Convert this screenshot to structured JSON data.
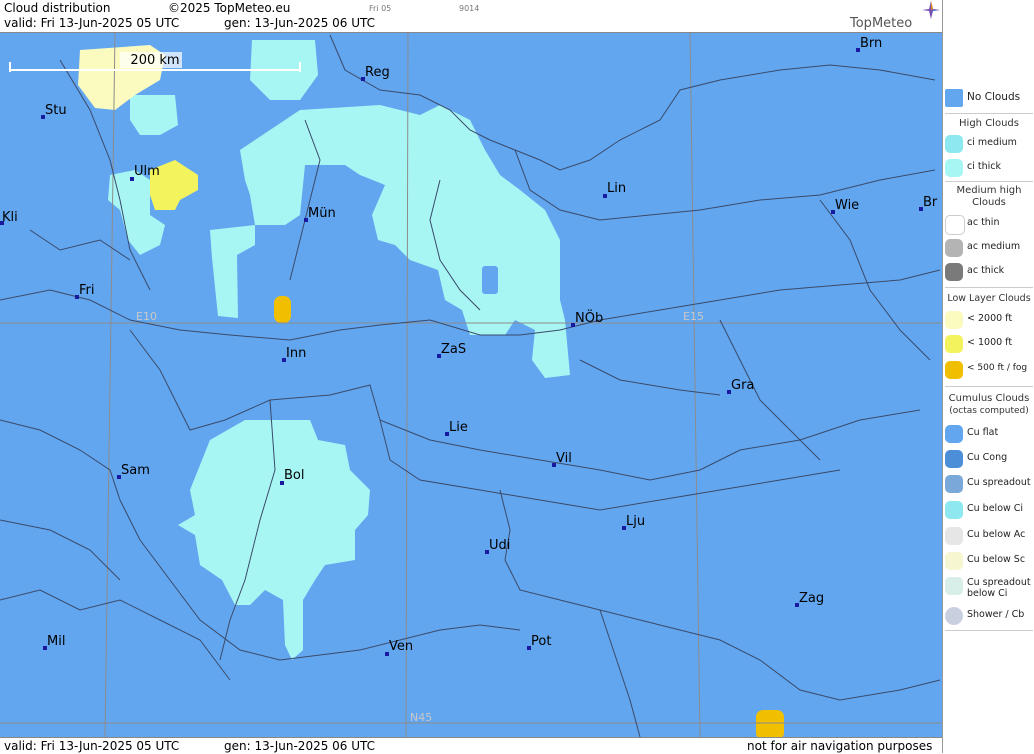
{
  "header": {
    "title": "Cloud distribution",
    "copyright": "©2025 TopMeteo.eu",
    "day_label": "Fri 05",
    "code_label": "9014",
    "valid": "valid:  Fri  13-Jun-2025  05 UTC",
    "gen": "gen: 13-Jun-2025 06 UTC",
    "brand": "TopMeteo"
  },
  "footer": {
    "valid": "valid:  Fri  13-Jun-2025  05 UTC",
    "gen": "gen: 13-Jun-2025 06 UTC",
    "disclaimer": "not for air navigation purposes"
  },
  "map": {
    "scale_label": "200 km",
    "grid_labels": {
      "e10": "E10",
      "e15": "E15",
      "n45": "N45"
    },
    "cities": [
      "Brn",
      "Reg",
      "Stu",
      "Ulm",
      "Lin",
      "Kli",
      "Mün",
      "Wie",
      "Br",
      "Fri",
      "NÖb",
      "Inn",
      "ZaS",
      "Gra",
      "Lie",
      "Vil",
      "Sam",
      "Bol",
      "Lju",
      "Udi",
      "Zag",
      "Mil",
      "Ven",
      "Pot"
    ]
  },
  "legend": {
    "no_clouds": "No Clouds",
    "high_title": "High Clouds",
    "ci_medium": "ci medium",
    "ci_thick": "ci thick",
    "medium_title": "Medium high Clouds",
    "ac_thin": "ac thin",
    "ac_medium": "ac medium",
    "ac_thick": "ac thick",
    "low_title": "Low Layer Clouds",
    "low_2000": "< 2000 ft",
    "low_1000": "< 1000 ft",
    "low_500": "< 500 ft / fog",
    "cu_title": "Cumulus Clouds",
    "cu_sub": "(octas computed)",
    "cu_flat": "Cu flat",
    "cu_cong": "Cu Cong",
    "cu_spread": "Cu spreadout",
    "cu_below_ci": "Cu below Ci",
    "cu_below_ac": "Cu below Ac",
    "cu_below_sc": "Cu below Sc",
    "cu_spread_ci": "Cu spreadout below Ci",
    "shower": "Shower / Cb"
  },
  "colors": {
    "no_clouds": "#62a6f0",
    "ci_medium": "#8ee8f0",
    "ci_thick": "#a8f6f4",
    "low_2000": "#fbfbc0",
    "low_1000": "#f3f35e",
    "fog": "#f0c000",
    "border": "#3a4a6a"
  }
}
